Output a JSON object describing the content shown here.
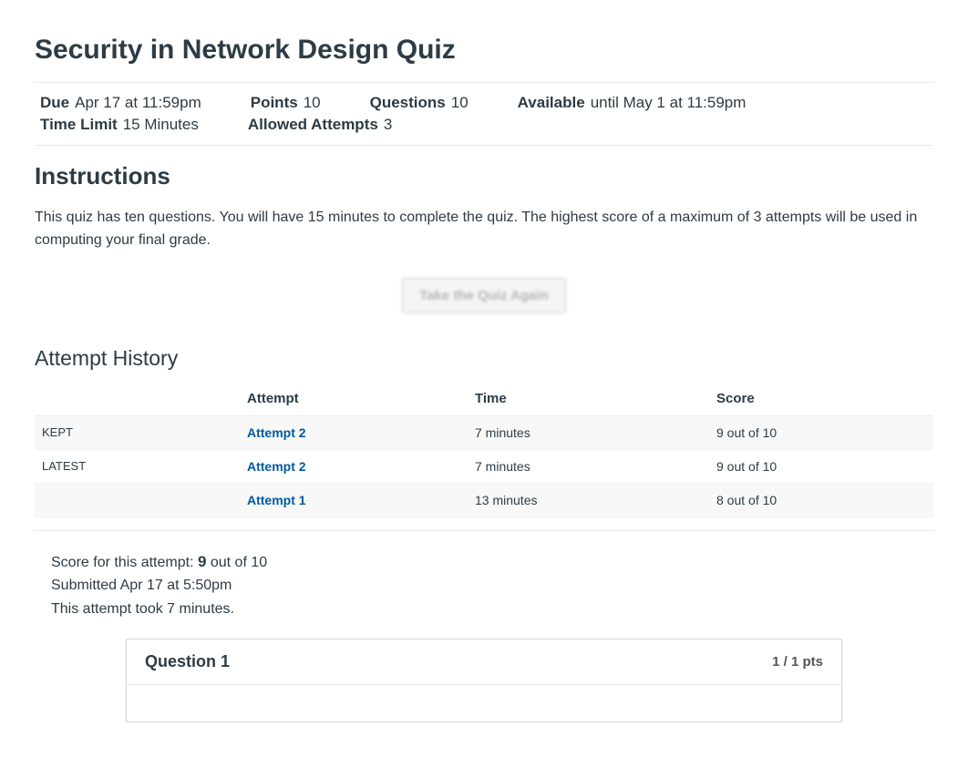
{
  "title": "Security in Network Design Quiz",
  "meta": {
    "due": {
      "label": "Due",
      "value": "Apr 17 at 11:59pm"
    },
    "points": {
      "label": "Points",
      "value": "10"
    },
    "questions": {
      "label": "Questions",
      "value": "10"
    },
    "available": {
      "label": "Available",
      "value": "until May 1 at 11:59pm"
    },
    "time_limit": {
      "label": "Time Limit",
      "value": "15 Minutes"
    },
    "attempts": {
      "label": "Allowed Attempts",
      "value": "3"
    }
  },
  "instructions": {
    "heading": "Instructions",
    "text": "This quiz has ten questions. You will have 15 minutes to complete the quiz. The highest score of a maximum of 3 attempts will be used in computing your final grade."
  },
  "take_again_label": "Take the Quiz Again",
  "history": {
    "heading": "Attempt History",
    "columns": {
      "attempt": "Attempt",
      "time": "Time",
      "score": "Score"
    },
    "rows": [
      {
        "tag": "KEPT",
        "attempt": "Attempt 2",
        "time": "7 minutes",
        "score": "9 out of 10"
      },
      {
        "tag": "LATEST",
        "attempt": "Attempt 2",
        "time": "7 minutes",
        "score": "9 out of 10"
      },
      {
        "tag": "",
        "attempt": "Attempt 1",
        "time": "13 minutes",
        "score": "8 out of 10"
      }
    ]
  },
  "score_block": {
    "prefix": "Score for this attempt: ",
    "score": "9",
    "suffix": " out of 10",
    "submitted": "Submitted Apr 17 at 5:50pm",
    "duration": "This attempt took 7 minutes."
  },
  "question1": {
    "label": "Question 1",
    "pts": "1 / 1 pts"
  }
}
